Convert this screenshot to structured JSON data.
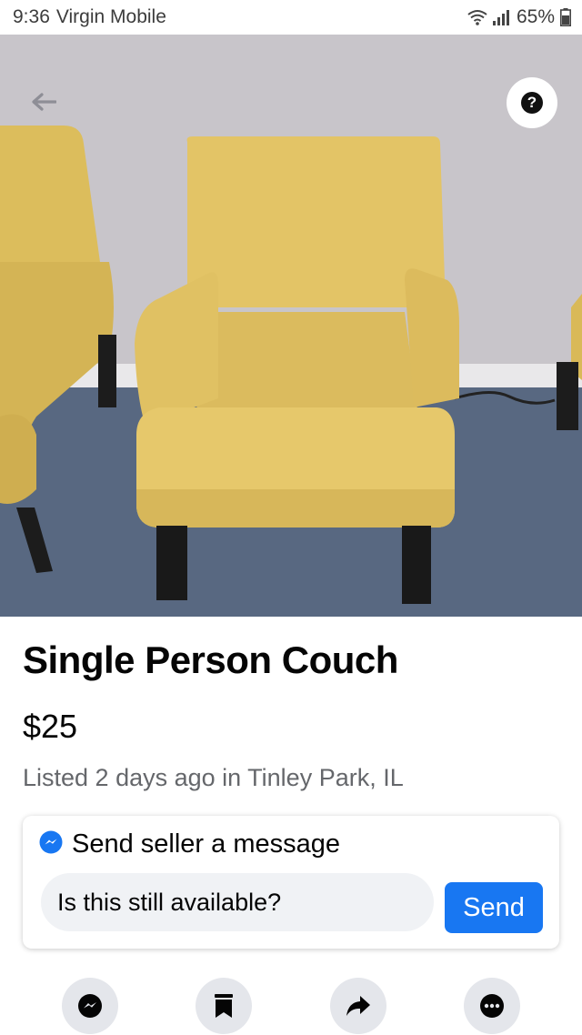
{
  "status_bar": {
    "time": "9:36",
    "carrier": "Virgin Mobile",
    "battery": "65%",
    "icons": [
      "wifi-icon",
      "signal-icon",
      "battery-icon"
    ]
  },
  "photo": {
    "back_icon": "back-arrow-icon",
    "help_icon": "help-icon",
    "help_glyph": "?"
  },
  "listing": {
    "title": "Single Person Couch",
    "price": "$25",
    "meta": "Listed 2 days ago in Tinley Park, IL"
  },
  "message": {
    "header_icon": "messenger-icon",
    "header": "Send seller a message",
    "input_value": "Is this still available?",
    "send_label": "Send"
  },
  "actions": [
    {
      "icon": "messenger-icon"
    },
    {
      "icon": "bookmark-icon"
    },
    {
      "icon": "share-icon"
    },
    {
      "icon": "more-icon"
    }
  ],
  "colors": {
    "accent": "#1877f2",
    "secondary_text": "#65676b",
    "input_bg": "#f0f2f5",
    "action_bg": "#e4e6eb"
  }
}
